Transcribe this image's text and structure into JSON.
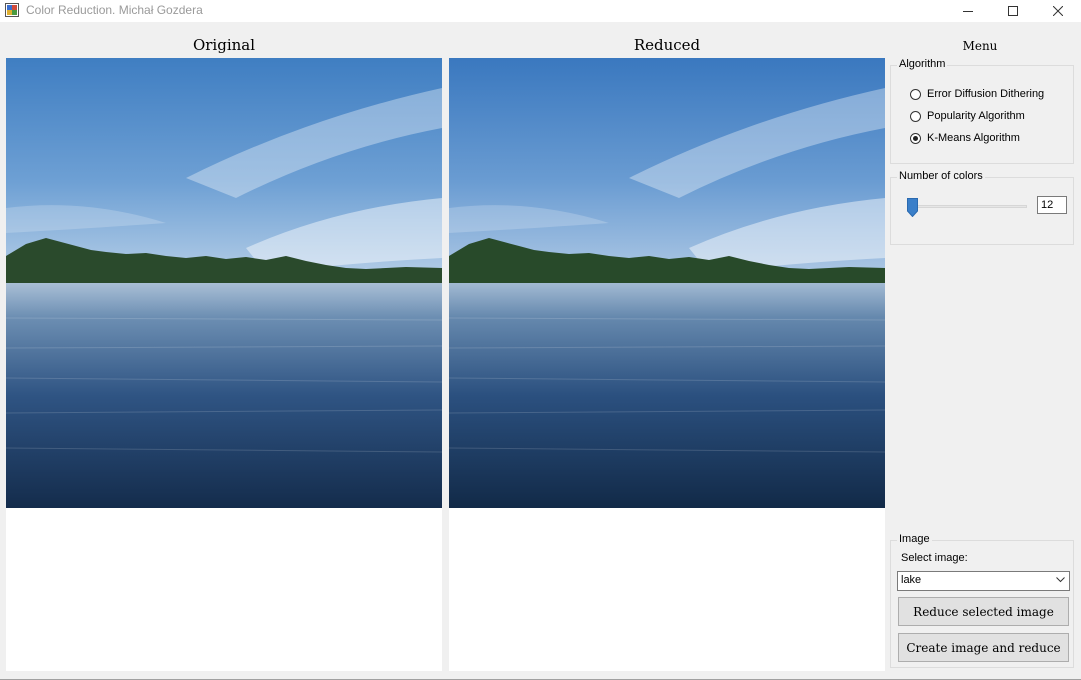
{
  "window": {
    "title": "Color Reduction. Michał Gozdera"
  },
  "panels": {
    "original_title": "Original",
    "reduced_title": "Reduced",
    "menu_title": "Menu"
  },
  "algorithm": {
    "group_label": "Algorithm",
    "options": [
      {
        "label": "Error Diffusion Dithering",
        "checked": false
      },
      {
        "label": "Popularity Algorithm",
        "checked": false
      },
      {
        "label": "K-Means Algorithm",
        "checked": true
      }
    ]
  },
  "colors": {
    "group_label": "Number of colors",
    "value": "12"
  },
  "image": {
    "group_label": "Image",
    "select_label": "Select image:",
    "selected": "lake",
    "reduce_button": "Reduce selected image",
    "create_button": "Create image and reduce"
  },
  "icons": {
    "app": "app-window-icon",
    "minimize": "minimize-icon",
    "maximize": "maximize-icon",
    "close": "close-icon",
    "dropdown": "chevron-down-icon"
  },
  "colors_theme": {
    "slider_thumb": "#3a7fc9",
    "window_bg": "#f0f0f0"
  }
}
